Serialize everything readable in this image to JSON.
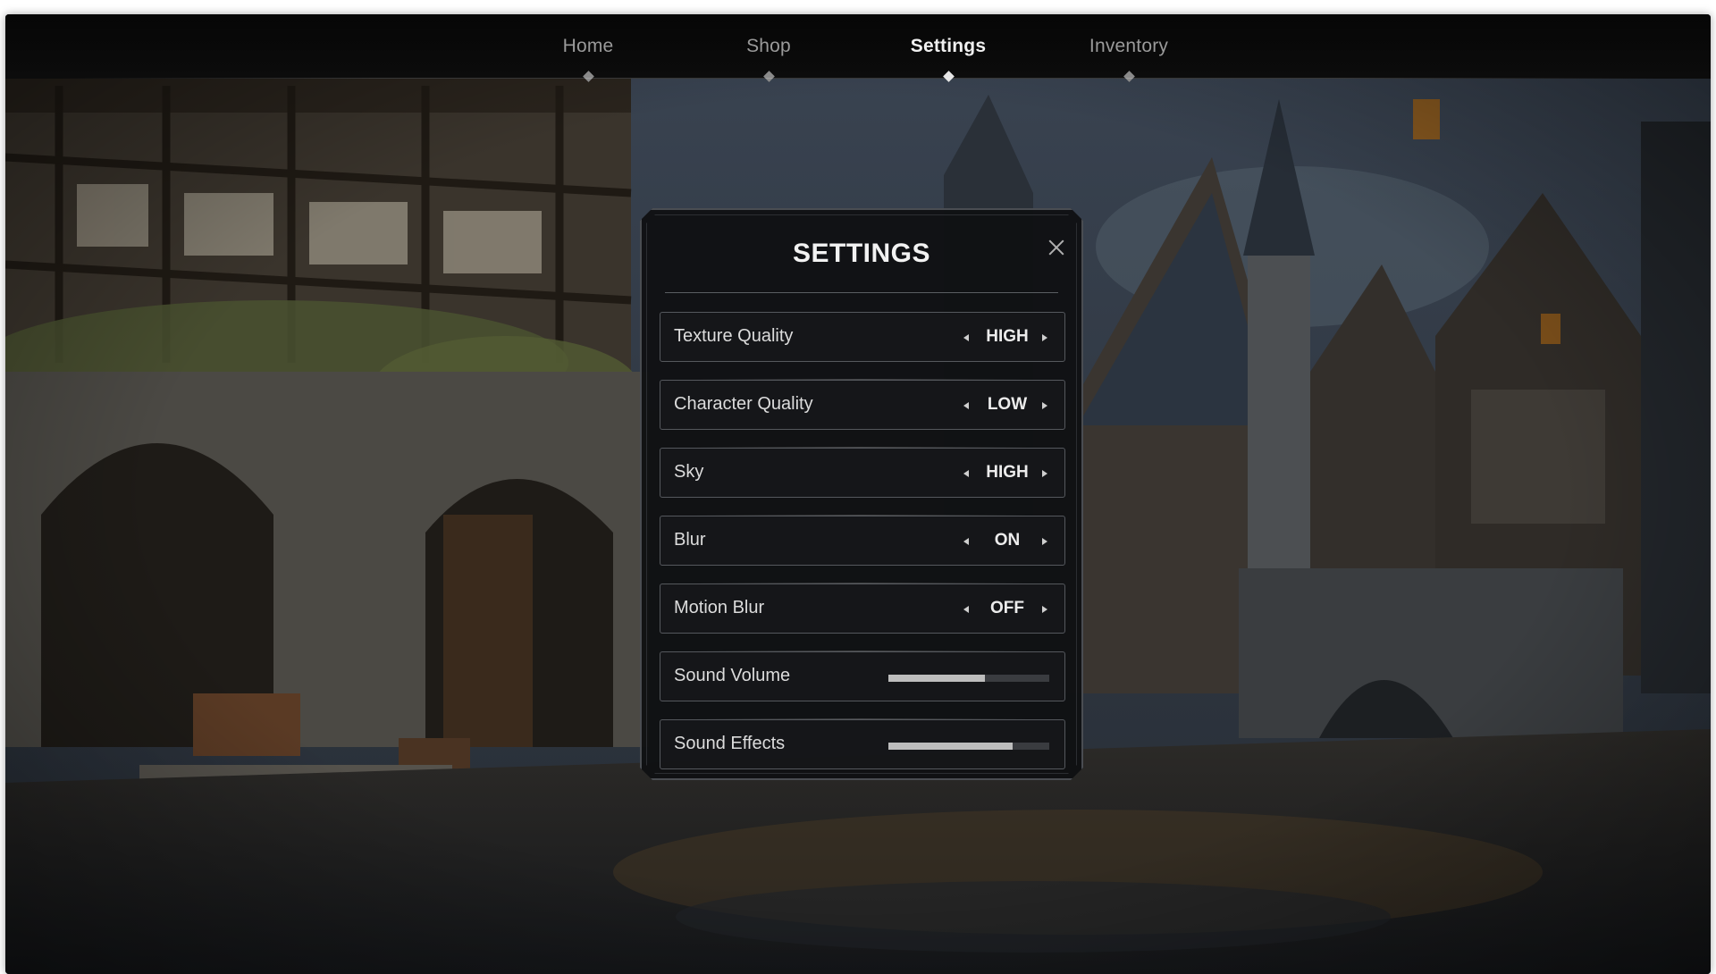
{
  "nav": {
    "items": [
      {
        "label": "Home",
        "active": false
      },
      {
        "label": "Shop",
        "active": false
      },
      {
        "label": "Settings",
        "active": true
      },
      {
        "label": "Inventory",
        "active": false
      }
    ]
  },
  "settings": {
    "title": "SETTINGS",
    "close_icon": "close-icon",
    "options": [
      {
        "label": "Texture Quality",
        "value": "HIGH"
      },
      {
        "label": "Character Quality",
        "value": "LOW"
      },
      {
        "label": "Sky",
        "value": "HIGH"
      },
      {
        "label": "Blur",
        "value": "ON"
      },
      {
        "label": "Motion Blur",
        "value": "OFF"
      }
    ],
    "sliders": [
      {
        "label": "Sound Volume",
        "level": 0.6
      },
      {
        "label": "Sound Effects",
        "level": 0.77
      }
    ]
  },
  "colors": {
    "panel_bg": "#101113",
    "panel_border": "#4a4d52",
    "slider_fill": "#bdbdbd",
    "slider_track": "#3a3c40"
  }
}
